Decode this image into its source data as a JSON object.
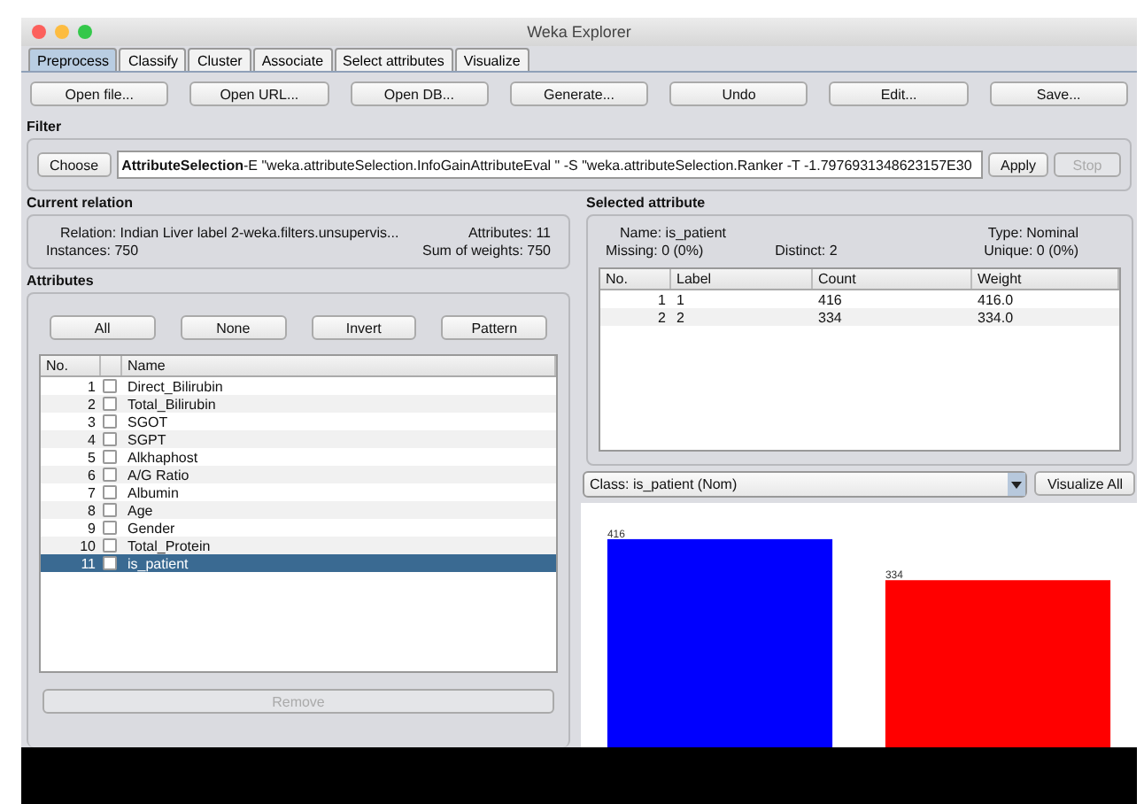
{
  "window": {
    "title": "Weka Explorer"
  },
  "tabs": [
    {
      "label": "Preprocess",
      "selected": true
    },
    {
      "label": "Classify",
      "selected": false
    },
    {
      "label": "Cluster",
      "selected": false
    },
    {
      "label": "Associate",
      "selected": false
    },
    {
      "label": "Select attributes",
      "selected": false
    },
    {
      "label": "Visualize",
      "selected": false
    }
  ],
  "toolbar": [
    "Open file...",
    "Open URL...",
    "Open DB...",
    "Generate...",
    "Undo",
    "Edit...",
    "Save..."
  ],
  "filter": {
    "heading": "Filter",
    "choose": "Choose",
    "name": "AttributeSelection",
    "options": " -E \"weka.attributeSelection.InfoGainAttributeEval \" -S \"weka.attributeSelection.Ranker -T -1.7976931348623157E30",
    "apply": {
      "label": "Apply",
      "disabled": false
    },
    "stop": {
      "label": "Stop",
      "disabled": true
    }
  },
  "current_relation": {
    "heading": "Current relation",
    "relation": "Relation: Indian Liver label 2-weka.filters.unsupervis...",
    "instances": "Instances: 750",
    "attributes": "Attributes: 11",
    "sum_of_weights": "Sum of weights: 750"
  },
  "attributes": {
    "heading": "Attributes",
    "buttons": [
      "All",
      "None",
      "Invert",
      "Pattern"
    ],
    "columns": [
      "No.",
      "Name"
    ],
    "rows": [
      {
        "no": "1",
        "name": "Direct_Bilirubin",
        "checked": false,
        "selected": false
      },
      {
        "no": "2",
        "name": "Total_Bilirubin",
        "checked": false,
        "selected": false
      },
      {
        "no": "3",
        "name": "SGOT",
        "checked": false,
        "selected": false
      },
      {
        "no": "4",
        "name": "SGPT",
        "checked": false,
        "selected": false
      },
      {
        "no": "5",
        "name": "Alkhaphost",
        "checked": false,
        "selected": false
      },
      {
        "no": "6",
        "name": "A/G Ratio",
        "checked": false,
        "selected": false
      },
      {
        "no": "7",
        "name": "Albumin",
        "checked": false,
        "selected": false
      },
      {
        "no": "8",
        "name": "Age",
        "checked": false,
        "selected": false
      },
      {
        "no": "9",
        "name": "Gender",
        "checked": false,
        "selected": false
      },
      {
        "no": "10",
        "name": "Total_Protein",
        "checked": false,
        "selected": false
      },
      {
        "no": "11",
        "name": "is_patient",
        "checked": false,
        "selected": true
      }
    ],
    "remove": {
      "label": "Remove",
      "disabled": true
    }
  },
  "selected_attribute": {
    "heading": "Selected attribute",
    "name": "Name: is_patient",
    "type": "Type: Nominal",
    "missing": "Missing: 0 (0%)",
    "distinct": "Distinct: 2",
    "unique": "Unique: 0 (0%)",
    "columns": [
      "No.",
      "Label",
      "Count",
      "Weight"
    ],
    "rows": [
      [
        "1",
        "1",
        "416",
        "416.0"
      ],
      [
        "2",
        "2",
        "334",
        "334.0"
      ]
    ]
  },
  "class_select": {
    "value": "Class: is_patient (Nom)"
  },
  "visualize_all": "Visualize All",
  "chart": {
    "chart_data": {
      "type": "bar",
      "series": [
        {
          "color": "#0000ff",
          "values": [
            416,
            null
          ]
        },
        {
          "color": "#ff0000",
          "values": [
            null,
            334
          ]
        }
      ],
      "stacked": true,
      "data_labels": true
    }
  }
}
